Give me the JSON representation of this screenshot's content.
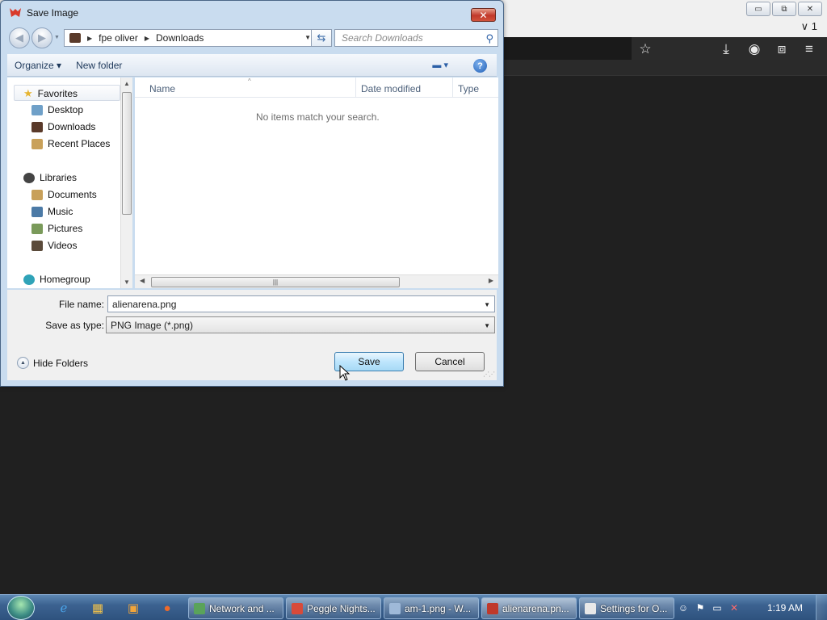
{
  "browser": {
    "tab_count": "1",
    "restore_glyph": "⧉",
    "minimize_glyph": "▭",
    "close_glyph": "✕"
  },
  "dialog": {
    "title": "Save Image",
    "close_glyph": "✕",
    "address": {
      "segments": [
        "fpe oliver",
        "Downloads"
      ]
    },
    "search_placeholder": "Search Downloads",
    "commands": {
      "organize": "Organize",
      "new_folder": "New folder"
    },
    "help_glyph": "?",
    "nav": {
      "favorites": "Favorites",
      "favorites_items": [
        "Desktop",
        "Downloads",
        "Recent Places"
      ],
      "libraries": "Libraries",
      "libraries_items": [
        "Documents",
        "Music",
        "Pictures",
        "Videos"
      ],
      "homegroup": "Homegroup"
    },
    "columns": {
      "name": "Name",
      "date_modified": "Date modified",
      "type": "Type"
    },
    "empty_message": "No items match your search.",
    "file_name_label": "File name:",
    "file_name_value": "alienarena.png",
    "save_type_label": "Save as type:",
    "save_type_value": "PNG Image (*.png)",
    "hide_folders": "Hide Folders",
    "save": "Save",
    "cancel": "Cancel"
  },
  "taskbar": {
    "buttons": [
      {
        "label": "Network and ...",
        "color": "#5aa35a"
      },
      {
        "label": "Peggle Nights...",
        "color": "#d84a3a"
      },
      {
        "label": "am-1.png - W...",
        "color": "#9fb9d8"
      },
      {
        "label": "alienarena.pn...",
        "color": "#c0392b"
      },
      {
        "label": "Settings for O...",
        "color": "#e8e8e8"
      }
    ],
    "clock": "1:19 AM"
  }
}
